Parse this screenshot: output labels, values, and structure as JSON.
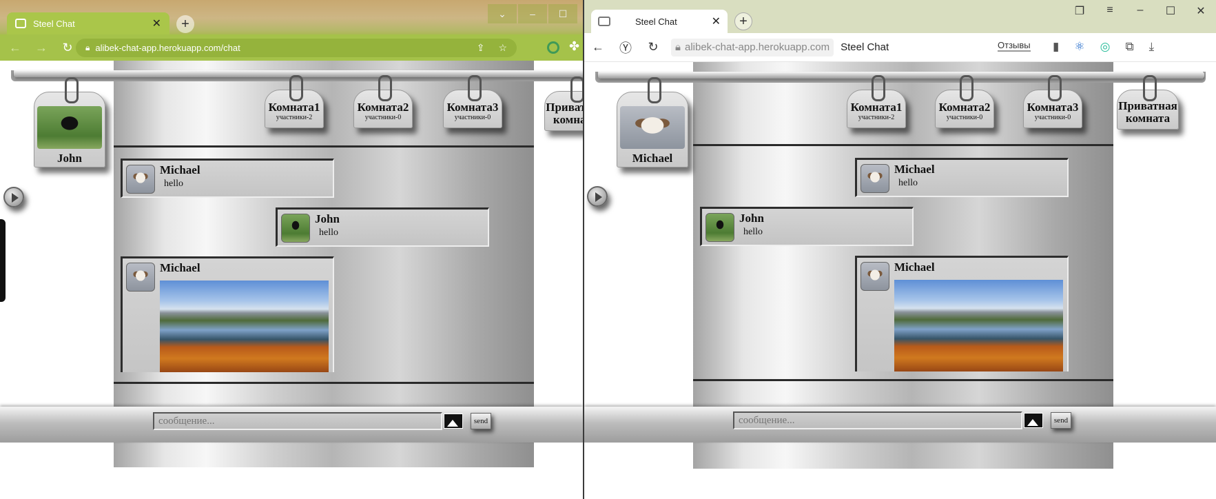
{
  "left_browser": {
    "tab_title": "Steel Chat",
    "url": "alibek-chat-app.herokuapp.com/chat"
  },
  "right_browser": {
    "tab_title": "Steel Chat",
    "url": "alibek-chat-app.herokuapp.com",
    "page_title": "Steel Chat",
    "reviews_label": "Отзывы"
  },
  "left_chat": {
    "current_user": "John",
    "rooms": [
      {
        "name": "Комната1",
        "count": "участники-2"
      },
      {
        "name": "Комната2",
        "count": "участники-0"
      },
      {
        "name": "Комната3",
        "count": "участники-0"
      }
    ],
    "private_room": "Приватная комната",
    "messages": [
      {
        "author": "Michael",
        "text": "hello"
      },
      {
        "author": "John",
        "text": "hello"
      },
      {
        "author": "Michael",
        "text": ""
      }
    ],
    "input_placeholder": "сообщение...",
    "send_label": "send"
  },
  "right_chat": {
    "current_user": "Michael",
    "rooms": [
      {
        "name": "Комната1",
        "count": "участники-2"
      },
      {
        "name": "Комната2",
        "count": "участники-0"
      },
      {
        "name": "Комната3",
        "count": "участники-0"
      }
    ],
    "private_room": "Приватная комната",
    "messages": [
      {
        "author": "Michael",
        "text": "hello"
      },
      {
        "author": "John",
        "text": "hello"
      },
      {
        "author": "Michael",
        "text": ""
      }
    ],
    "input_placeholder": "сообщение...",
    "send_label": "send"
  }
}
